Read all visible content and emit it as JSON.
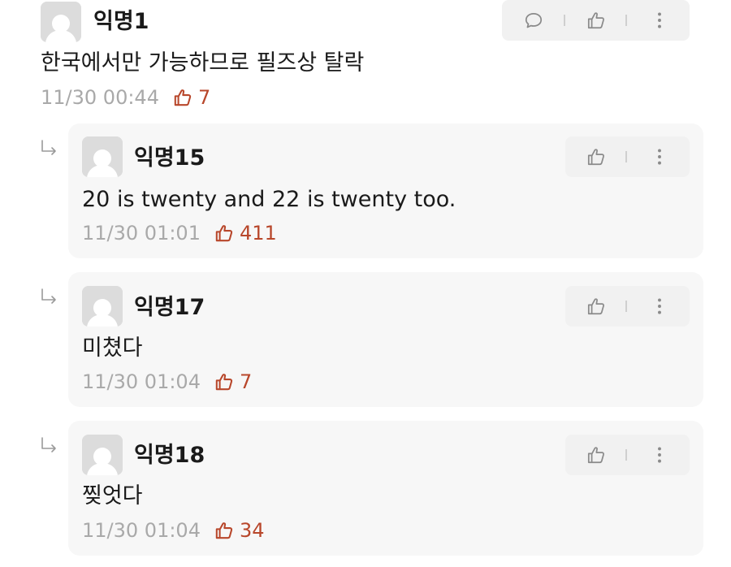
{
  "comments": [
    {
      "nickname": "익명1",
      "text": "한국에서만 가능하므로 필즈상 탈락",
      "time": "11/30 00:44",
      "votes": "7",
      "actions": [
        "comment-icon",
        "thumbs-up-icon",
        "more-vertical-icon"
      ]
    },
    {
      "nickname": "익명15",
      "text": "20 is twenty and 22 is twenty too.",
      "time": "11/30 01:01",
      "votes": "411",
      "actions": [
        "thumbs-up-icon",
        "more-vertical-icon"
      ]
    },
    {
      "nickname": "익명17",
      "text": "미쳤다",
      "time": "11/30 01:04",
      "votes": "7",
      "actions": [
        "thumbs-up-icon",
        "more-vertical-icon"
      ]
    },
    {
      "nickname": "익명18",
      "text": "찢엇다",
      "time": "11/30 01:04",
      "votes": "34",
      "actions": [
        "thumbs-up-icon",
        "more-vertical-icon"
      ]
    }
  ],
  "colors": {
    "vote": "#b8472b",
    "time": "#a9a9a9",
    "reply_bg": "#f7f7f7",
    "action_bg": "#f1f1f1"
  }
}
